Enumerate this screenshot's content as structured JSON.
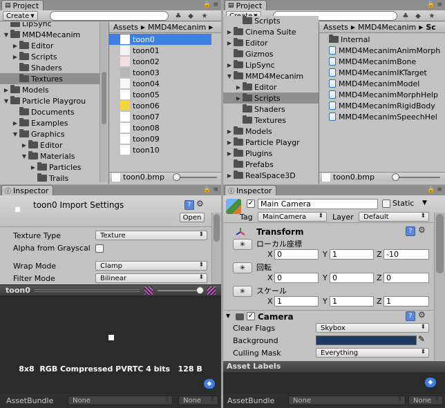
{
  "project_left": {
    "tab": "Project",
    "create": "Create",
    "tree": [
      {
        "label": "LipSync",
        "indent": 1,
        "arrow": ""
      },
      {
        "label": "MMD4Mecanim",
        "indent": 1,
        "arrow": "▼"
      },
      {
        "label": "Editor",
        "indent": 2,
        "arrow": "▶"
      },
      {
        "label": "Scripts",
        "indent": 2,
        "arrow": "▶"
      },
      {
        "label": "Shaders",
        "indent": 2,
        "arrow": ""
      },
      {
        "label": "Textures",
        "indent": 2,
        "arrow": "",
        "selected": true
      },
      {
        "label": "Models",
        "indent": 1,
        "arrow": "▶"
      },
      {
        "label": "Particle Playgrou",
        "indent": 1,
        "arrow": "▼"
      },
      {
        "label": "Documents",
        "indent": 2,
        "arrow": ""
      },
      {
        "label": "Examples",
        "indent": 2,
        "arrow": "▶"
      },
      {
        "label": "Graphics",
        "indent": 2,
        "arrow": "▼"
      },
      {
        "label": "Editor",
        "indent": 3,
        "arrow": "▶"
      },
      {
        "label": "Materials",
        "indent": 3,
        "arrow": "▼"
      },
      {
        "label": "Particles",
        "indent": 4,
        "arrow": "▶"
      },
      {
        "label": "Trails",
        "indent": 4,
        "arrow": ""
      }
    ],
    "breadcrumb": [
      "Assets",
      "MMD4Mecanim"
    ],
    "files": [
      "toon0",
      "toon01",
      "toon02",
      "toon03",
      "toon04",
      "toon05",
      "toon06",
      "toon07",
      "toon08",
      "toon09",
      "toon10"
    ],
    "status_file": "toon0.bmp"
  },
  "project_right": {
    "tab": "Project",
    "create": "Create",
    "tree": [
      {
        "label": "Scripts",
        "indent": 2,
        "arrow": ""
      },
      {
        "label": "Cinema Suite",
        "indent": 1,
        "arrow": "▶"
      },
      {
        "label": "Editor",
        "indent": 1,
        "arrow": "▶"
      },
      {
        "label": "Gizmos",
        "indent": 1,
        "arrow": ""
      },
      {
        "label": "LipSync",
        "indent": 1,
        "arrow": "▶"
      },
      {
        "label": "MMD4Mecanim",
        "indent": 1,
        "arrow": "▼"
      },
      {
        "label": "Editor",
        "indent": 2,
        "arrow": "▶"
      },
      {
        "label": "Scripts",
        "indent": 2,
        "arrow": "▶",
        "selected": true
      },
      {
        "label": "Shaders",
        "indent": 2,
        "arrow": ""
      },
      {
        "label": "Textures",
        "indent": 2,
        "arrow": ""
      },
      {
        "label": "Models",
        "indent": 1,
        "arrow": "▶"
      },
      {
        "label": "Particle Playgr",
        "indent": 1,
        "arrow": "▶"
      },
      {
        "label": "Plugins",
        "indent": 1,
        "arrow": "▶"
      },
      {
        "label": "Prefabs",
        "indent": 1,
        "arrow": ""
      },
      {
        "label": "RealSpace3D",
        "indent": 1,
        "arrow": "▶"
      }
    ],
    "breadcrumb": [
      "Assets",
      "MMD4Mecanim",
      "Sc"
    ],
    "files": [
      {
        "label": "Internal",
        "kind": "folder"
      },
      {
        "label": "MMD4MecanimAnimMorph",
        "kind": "script"
      },
      {
        "label": "MMD4MecanimBone",
        "kind": "script"
      },
      {
        "label": "MMD4MecanimIKTarget",
        "kind": "script"
      },
      {
        "label": "MMD4MecanimModel",
        "kind": "script"
      },
      {
        "label": "MMD4MecanimMorphHelp",
        "kind": "script"
      },
      {
        "label": "MMD4MecanimRigidBody",
        "kind": "script"
      },
      {
        "label": "MMD4MecanimSpeechHel",
        "kind": "script"
      }
    ],
    "status_file": "toon0.bmp"
  },
  "inspector_left": {
    "tab": "Inspector",
    "title": "toon0 Import Settings",
    "open": "Open",
    "texture_type_label": "Texture Type",
    "texture_type_value": "Texture",
    "alpha_label": "Alpha from Grayscal",
    "wrap_label": "Wrap Mode",
    "wrap_value": "Clamp",
    "filter_label": "Filter Mode",
    "filter_value": "Bilinear",
    "preview_title": "toon0",
    "preview_info": "8x8  RGB Compressed PVRTC 4 bits   128 B",
    "assetbundle_label": "AssetBundle",
    "assetbundle_value": "None",
    "assetbundle_variant": "None"
  },
  "inspector_right": {
    "tab": "Inspector",
    "name": "Main Camera",
    "static": "Static",
    "tag_label": "Tag",
    "tag_value": "MainCamera",
    "layer_label": "Layer",
    "layer_value": "Default",
    "transform": {
      "title": "Transform",
      "position_label": "ローカル座標",
      "rotation_label": "回転",
      "scale_label": "スケール",
      "position": {
        "x": "0",
        "y": "1",
        "z": "-10"
      },
      "rotation": {
        "x": "0",
        "y": "0",
        "z": "0"
      },
      "scale": {
        "x": "1",
        "y": "1",
        "z": "1"
      }
    },
    "camera": {
      "title": "Camera",
      "clear_flags_label": "Clear Flags",
      "clear_flags_value": "Skybox",
      "background_label": "Background",
      "background_color": "#1f3a5e",
      "culling_label": "Culling Mask",
      "culling_value": "Everything"
    },
    "asset_labels": "Asset Labels",
    "assetbundle_label": "AssetBundle",
    "assetbundle_value": "None",
    "assetbundle_variant": "None"
  },
  "colors": {
    "selection": "#3d80df",
    "panel": "#c2c2c2",
    "preview_bg": "#2b2b2b"
  }
}
